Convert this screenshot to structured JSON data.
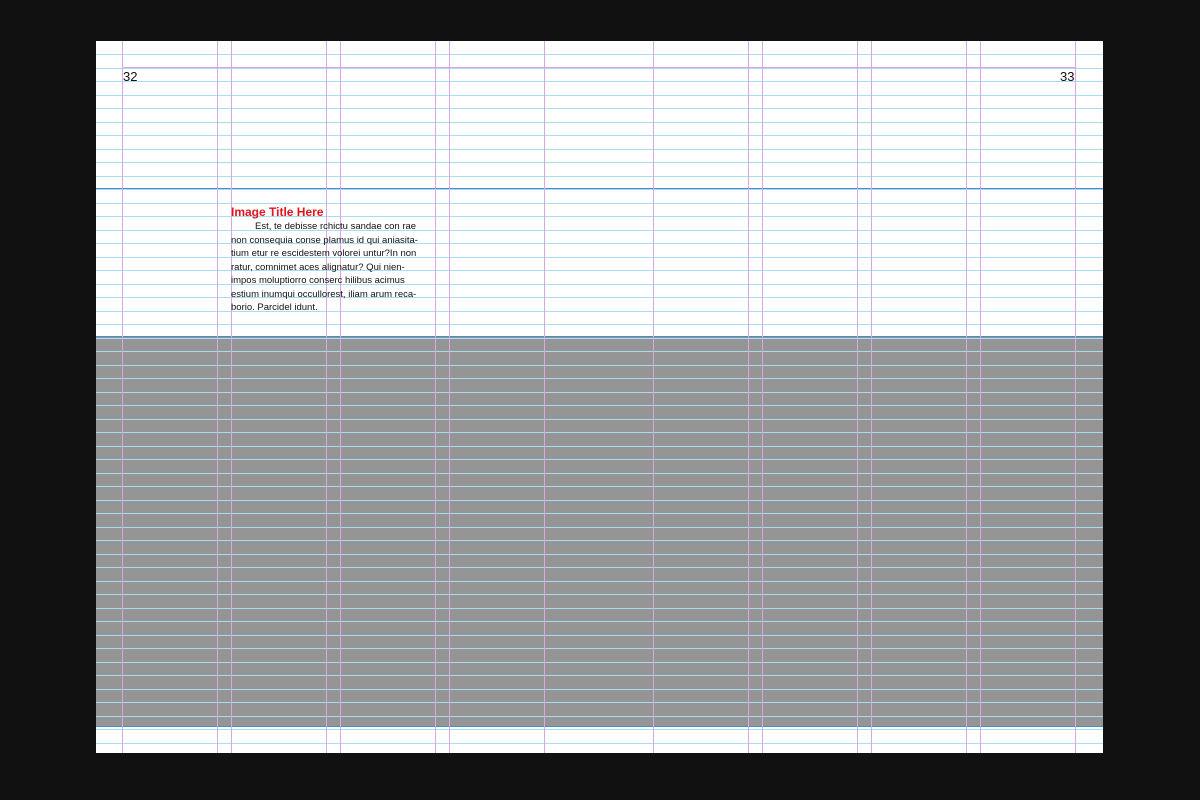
{
  "spread": {
    "left_page_number": "32",
    "right_page_number": "33"
  },
  "caption": {
    "title": "Image Title Here",
    "body_lines": [
      "Est, te debisse rchictu sandae con rae",
      "non consequia conse plamus id qui aniasita-",
      "tium etur re escidestem volorei untur?In non",
      "ratur, comnimet aces alignatur? Qui nien-",
      "impos moluptiorro conserc hilibus acimus",
      "estium inumqui occullorest, iliam arum reca-",
      "borio. Parcidel idunt."
    ]
  },
  "colors": {
    "background": "#111111",
    "page": "#ffffff",
    "image_placeholder": "#959596",
    "baseline_guide": "#a9dcef",
    "column_guide": "#d7a8e3",
    "section_guide": "#3f8fc8",
    "caption_title": "#e3141b"
  }
}
